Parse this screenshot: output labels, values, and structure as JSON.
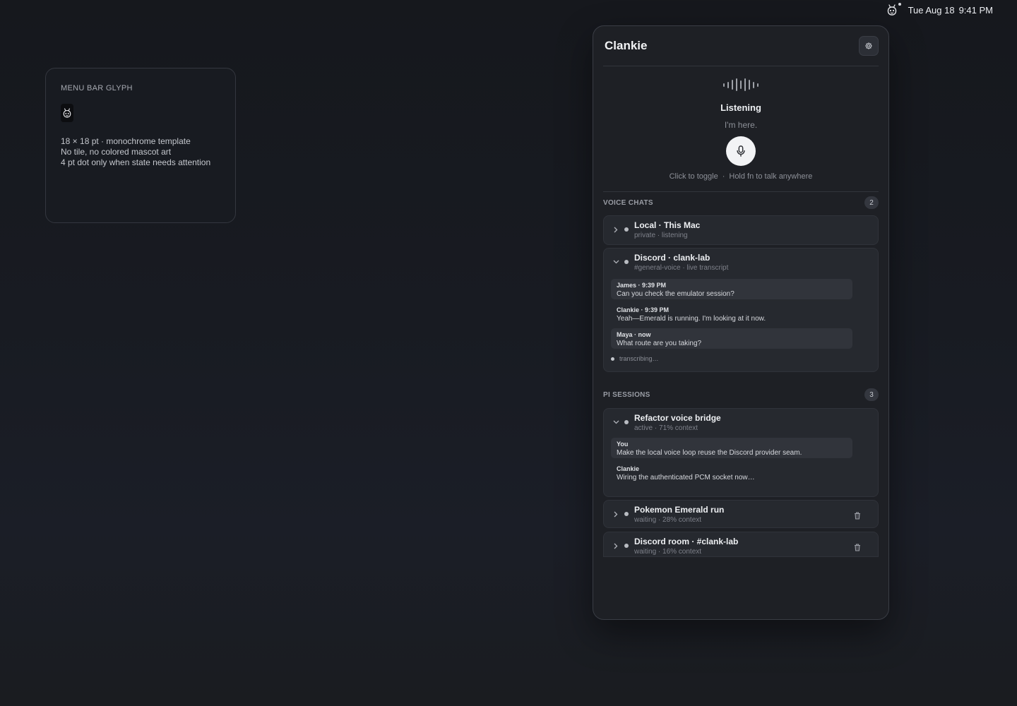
{
  "menubar": {
    "date": "Tue Aug 18",
    "time": "9:41 PM",
    "glyph_icon": "clankie-mascot-icon"
  },
  "glyph_card": {
    "eyebrow": "MENU BAR GLYPH",
    "lines": [
      "18 × 18 pt · monochrome template",
      "No tile, no colored mascot art",
      "4 pt dot only when state needs attention"
    ]
  },
  "panel": {
    "title": "Clankie",
    "settings_icon": "gear-icon",
    "listening": {
      "status": "Listening",
      "subtitle": "I'm here.",
      "mic_icon": "microphone-icon",
      "hint_toggle": "Click to toggle",
      "hint_separator": "·",
      "hint_hold": "Hold fn to talk anywhere"
    },
    "voice_chats": {
      "label": "VOICE CHATS",
      "count": "2",
      "items": [
        {
          "title": "Local · This Mac",
          "subtitle": "private · listening",
          "expanded": false
        },
        {
          "title": "Discord · clank-lab",
          "subtitle": "#general-voice · live transcript",
          "expanded": true,
          "messages": [
            {
              "meta": "James · 9:39 PM",
              "text": "Can you check the emulator session?"
            },
            {
              "meta": "Clankie · 9:39 PM",
              "text": "Yeah—Emerald is running. I'm looking at it now."
            },
            {
              "meta": "Maya · now",
              "text": "What route are you taking?"
            }
          ],
          "status": "transcribing…"
        }
      ]
    },
    "pi_sessions": {
      "label": "PI SESSIONS",
      "count": "3",
      "items": [
        {
          "title": "Refactor voice bridge",
          "subtitle": "active · 71% context",
          "expanded": true,
          "messages": [
            {
              "meta": "You",
              "text": "Make the local voice loop reuse the Discord provider seam."
            },
            {
              "meta": "Clankie",
              "text": "Wiring the authenticated PCM socket now…"
            }
          ]
        },
        {
          "title": "Pokemon Emerald run",
          "subtitle": "waiting · 28% context",
          "expanded": false
        },
        {
          "title": "Discord room · #clank-lab",
          "subtitle": "waiting · 16% context",
          "expanded": false
        }
      ]
    }
  }
}
